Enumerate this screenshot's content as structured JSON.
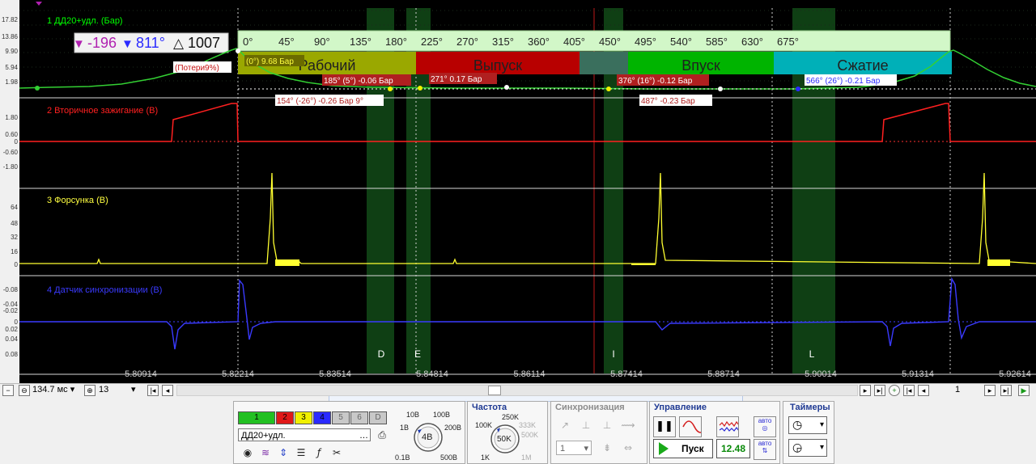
{
  "channels": [
    {
      "title": "1 ДД20+удл. (Бар)",
      "color": "#00ff00",
      "ticks": [
        "17.82",
        "13.86",
        "9.90",
        "5.94",
        "1.98"
      ]
    },
    {
      "title": "2 Вторичное зажигание (В)",
      "color": "#ff2020",
      "ticks": [
        "1.80",
        "0.60",
        "0",
        "-0.60",
        "-1.80"
      ]
    },
    {
      "title": "3 Форсунка (В)",
      "color": "#ffff40",
      "ticks": [
        "64",
        "48",
        "32",
        "16",
        "0"
      ]
    },
    {
      "title": "4 Датчик синхронизации (В)",
      "color": "#3a3aff",
      "ticks": [
        "-0.08",
        "-0.04",
        "-0.02",
        "0",
        "0.02",
        "0.04",
        "0.08"
      ]
    }
  ],
  "measure": {
    "a": "-196",
    "b": "811°",
    "delta": "1007"
  },
  "degree_ticks": [
    "0°",
    "45°",
    "90°",
    "135°",
    "180°",
    "225°",
    "270°",
    "315°",
    "360°",
    "405°",
    "450°",
    "495°",
    "540°",
    "585°",
    "630°",
    "675°"
  ],
  "strokes": [
    {
      "label": "Рабочий",
      "color": "#9aa800"
    },
    {
      "label": "Выпуск",
      "color": "#b80000"
    },
    {
      "label": "Впуск",
      "color": "#00b400"
    },
    {
      "label": "Сжатие",
      "color": "#00b0b8"
    }
  ],
  "annotations": {
    "losses": "(Потери9%)",
    "p0": "(0°) 9.68 Бар",
    "p185": "185° (5°) -0.06 Бар",
    "p271": "271° 0.17 Бар",
    "p154": "154° (-26°) -0.26 Бар 9°",
    "p376": "376° (16°) -0.12 Бар",
    "p487": "487° -0.23 Бар",
    "p566": "566° (26°) -0.21 Бар"
  },
  "markers": [
    "D",
    "E",
    "I",
    "L"
  ],
  "time_ticks": [
    "5.80914",
    "5.82214",
    "5.83514",
    "5.84814",
    "5.86114",
    "5.87414",
    "5.88714",
    "5.90014",
    "5.91314",
    "5.92614"
  ],
  "bottom": {
    "zoom": "134.7 мс",
    "channel_count": "13",
    "page": "1",
    "channel_buttons": [
      "1",
      "2",
      "3",
      "4",
      "5",
      "6",
      "D"
    ],
    "sensor_name": "ДД20+удл.",
    "volts": {
      "value": "4В",
      "labels": [
        "10В",
        "100В",
        "1В",
        "200В",
        "0.1В",
        "500В"
      ]
    },
    "freq": {
      "title": "Частота",
      "value": "50K",
      "labels": [
        "250K",
        "100K",
        "333K",
        "500K",
        "1K",
        "1M"
      ]
    },
    "sync": {
      "title": "Синхронизация",
      "value": "1"
    },
    "control": {
      "title": "Управление",
      "start_label": "Пуск",
      "readout": "12.48"
    },
    "timers": {
      "title": "Таймеры"
    }
  }
}
